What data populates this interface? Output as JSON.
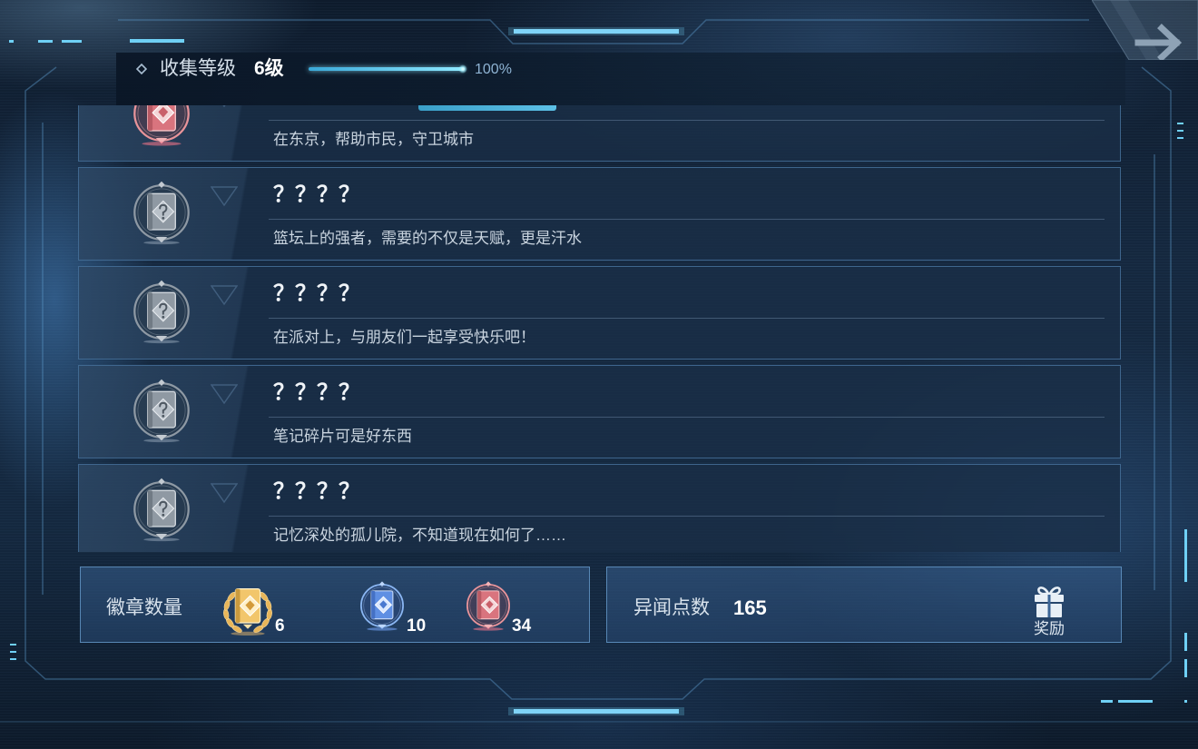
{
  "header": {
    "level_label": "收集等级",
    "level_value": "6级",
    "progress_text": "100%",
    "progress_fraction": 1.0
  },
  "achievements": [
    {
      "description": "在东京，帮助市民，守卫城市",
      "badge_icon": "pink-badge-icon",
      "locked": false
    },
    {
      "title": "？？？？",
      "description": "篮坛上的强者，需要的不仅是天赋，更是汗水",
      "badge_icon": "locked-badge-icon",
      "locked": true
    },
    {
      "title": "？？？？",
      "description": "在派对上，与朋友们一起享受快乐吧！",
      "badge_icon": "locked-badge-icon",
      "locked": true
    },
    {
      "title": "？？？？",
      "description": "笔记碎片可是好东西",
      "badge_icon": "locked-badge-icon",
      "locked": true
    },
    {
      "title": "？？？？",
      "description": "记忆深处的孤儿院，不知道现在如何了……",
      "badge_icon": "locked-badge-icon",
      "locked": true
    }
  ],
  "badge_summary": {
    "label": "徽章数量",
    "items": [
      {
        "icon": "gold-badge-icon",
        "count": "6"
      },
      {
        "icon": "blue-badge-icon",
        "count": "10"
      },
      {
        "icon": "pink-badge-icon",
        "count": "34"
      }
    ]
  },
  "points": {
    "label": "异闻点数",
    "value": "165",
    "reward_label": "奖励",
    "reward_icon": "gift-icon"
  },
  "top_right_button": {
    "icon": "arrow-right-icon"
  },
  "colors": {
    "accent_cyan": "#6fd0f5",
    "panel_border": "#6ea5d7",
    "title_text": "#f0f4f8",
    "description_text": "#c9d4df",
    "background": "#12233a"
  }
}
